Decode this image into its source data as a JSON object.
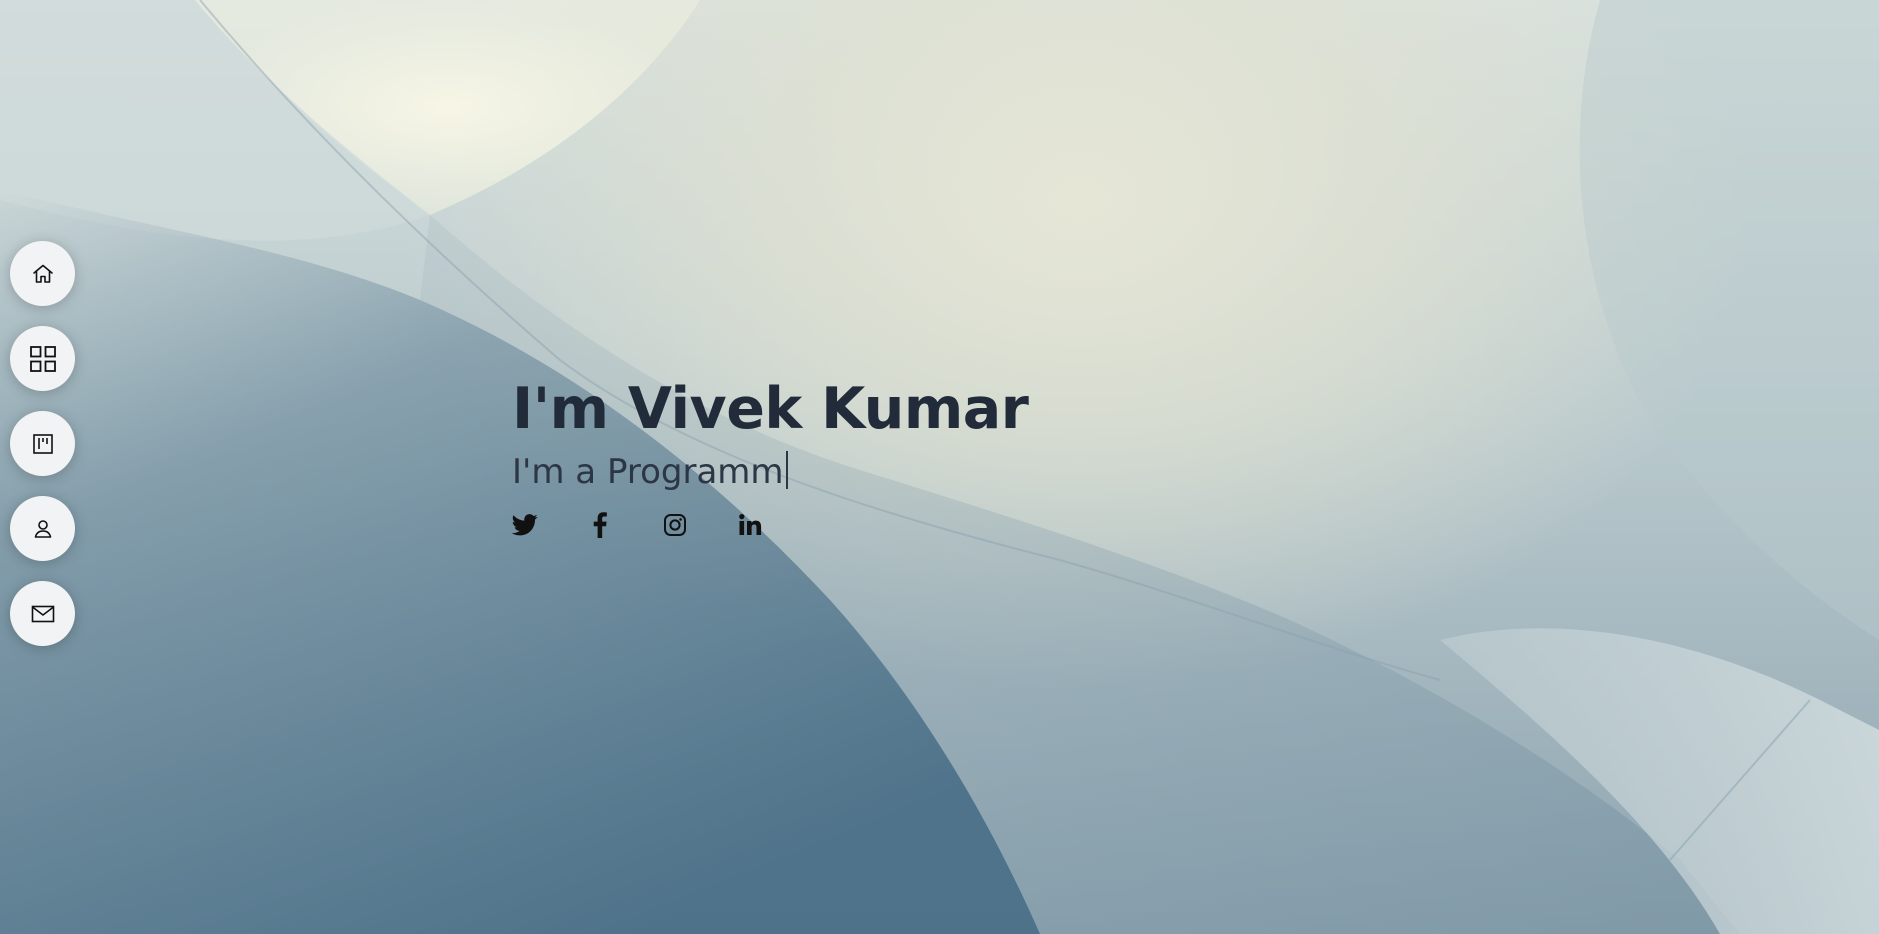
{
  "hero": {
    "title": "I'm Vivek Kumar",
    "subtitle": "I'm a Programm",
    "text_color": "#222b3a"
  },
  "side_nav": {
    "items": [
      {
        "icon": "home-icon"
      },
      {
        "icon": "grid-icon"
      },
      {
        "icon": "kanban-icon"
      },
      {
        "icon": "person-icon"
      },
      {
        "icon": "envelope-icon"
      }
    ],
    "button_color": "#f2f3f5"
  },
  "social": {
    "items": [
      {
        "icon": "twitter-icon"
      },
      {
        "icon": "facebook-icon"
      },
      {
        "icon": "instagram-icon"
      },
      {
        "icon": "linkedin-icon"
      }
    ]
  }
}
